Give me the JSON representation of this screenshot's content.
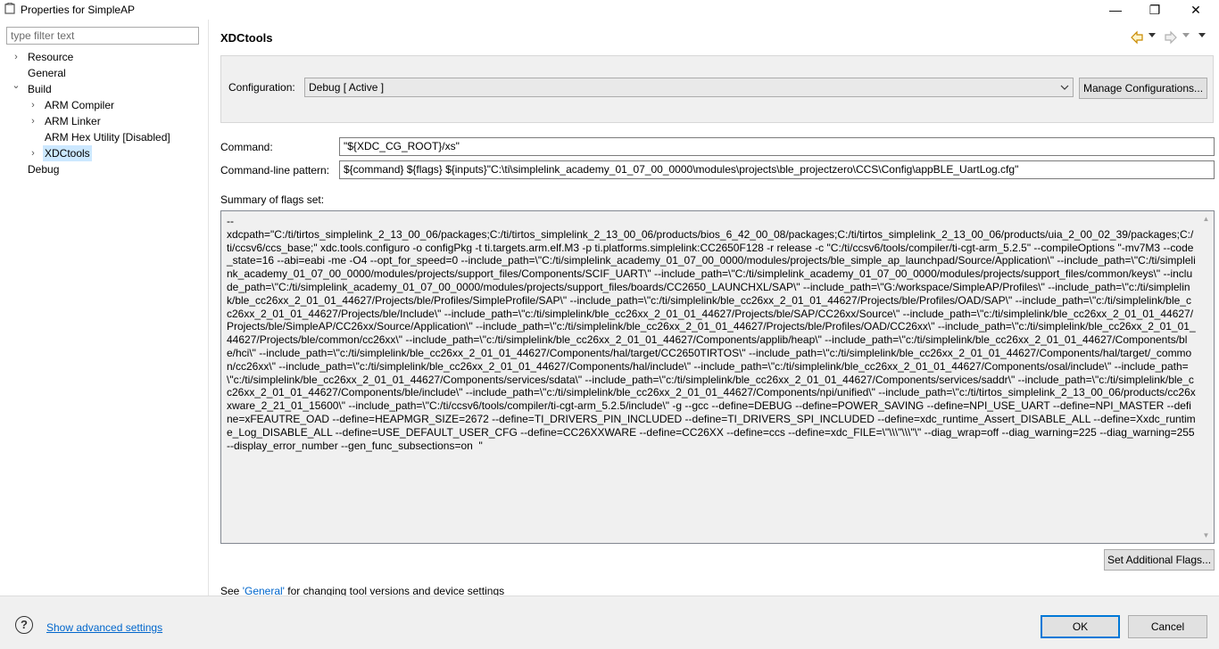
{
  "window": {
    "title": "Properties for SimpleAP",
    "minimize_glyph": "—",
    "maximize_glyph": "❐",
    "close_glyph": "✕"
  },
  "sidebar": {
    "filter_placeholder": "type filter text",
    "items": [
      {
        "label": "Resource",
        "arrow": "›"
      },
      {
        "label": "General",
        "arrow": ""
      },
      {
        "label": "Build",
        "arrow": "⌄"
      },
      {
        "label": "ARM Compiler",
        "arrow": "›"
      },
      {
        "label": "ARM Linker",
        "arrow": "›"
      },
      {
        "label": "ARM Hex Utility  [Disabled]",
        "arrow": ""
      },
      {
        "label": "XDCtools",
        "arrow": "›"
      },
      {
        "label": "Debug",
        "arrow": ""
      }
    ]
  },
  "main": {
    "title": "XDCtools",
    "configuration_label": "Configuration:",
    "configuration_value": "Debug  [ Active ]",
    "manage_button": "Manage Configurations...",
    "command_label": "Command:",
    "command_value": "\"${XDC_CG_ROOT}/xs\"",
    "pattern_label": "Command-line pattern:",
    "pattern_value": "${command} ${flags} ${inputs}\"C:\\ti\\simplelink_academy_01_07_00_0000\\modules\\projects\\ble_projectzero\\CCS\\Config\\appBLE_UartLog.cfg\"",
    "summary_label": "Summary of flags set:",
    "summary_text": "--\nxdcpath=\"C:/ti/tirtos_simplelink_2_13_00_06/packages;C:/ti/tirtos_simplelink_2_13_00_06/products/bios_6_42_00_08/packages;C:/ti/tirtos_simplelink_2_13_00_06/products/uia_2_00_02_39/packages;C:/ti/ccsv6/ccs_base;\" xdc.tools.configuro -o configPkg -t ti.targets.arm.elf.M3 -p ti.platforms.simplelink:CC2650F128 -r release -c \"C:/ti/ccsv6/tools/compiler/ti-cgt-arm_5.2.5\" --compileOptions \"-mv7M3 --code_state=16 --abi=eabi -me -O4 --opt_for_speed=0 --include_path=\\\"C:/ti/simplelink_academy_01_07_00_0000/modules/projects/ble_simple_ap_launchpad/Source/Application\\\" --include_path=\\\"C:/ti/simplelink_academy_01_07_00_0000/modules/projects/support_files/Components/SCIF_UART\\\" --include_path=\\\"C:/ti/simplelink_academy_01_07_00_0000/modules/projects/support_files/common/keys\\\" --include_path=\\\"C:/ti/simplelink_academy_01_07_00_0000/modules/projects/support_files/boards/CC2650_LAUNCHXL/SAP\\\" --include_path=\\\"G:/workspace/SimpleAP/Profiles\\\" --include_path=\\\"c:/ti/simplelink/ble_cc26xx_2_01_01_44627/Projects/ble/Profiles/SimpleProfile/SAP\\\" --include_path=\\\"c:/ti/simplelink/ble_cc26xx_2_01_01_44627/Projects/ble/Profiles/OAD/SAP\\\" --include_path=\\\"c:/ti/simplelink/ble_cc26xx_2_01_01_44627/Projects/ble/Include\\\" --include_path=\\\"c:/ti/simplelink/ble_cc26xx_2_01_01_44627/Projects/ble/SAP/CC26xx/Source\\\" --include_path=\\\"c:/ti/simplelink/ble_cc26xx_2_01_01_44627/Projects/ble/SimpleAP/CC26xx/Source/Application\\\" --include_path=\\\"c:/ti/simplelink/ble_cc26xx_2_01_01_44627/Projects/ble/Profiles/OAD/CC26xx\\\" --include_path=\\\"c:/ti/simplelink/ble_cc26xx_2_01_01_44627/Projects/ble/common/cc26xx\\\" --include_path=\\\"c:/ti/simplelink/ble_cc26xx_2_01_01_44627/Components/applib/heap\\\" --include_path=\\\"c:/ti/simplelink/ble_cc26xx_2_01_01_44627/Components/ble/hci\\\" --include_path=\\\"c:/ti/simplelink/ble_cc26xx_2_01_01_44627/Components/hal/target/CC2650TIRTOS\\\" --include_path=\\\"c:/ti/simplelink/ble_cc26xx_2_01_01_44627/Components/hal/target/_common/cc26xx\\\" --include_path=\\\"c:/ti/simplelink/ble_cc26xx_2_01_01_44627/Components/hal/include\\\" --include_path=\\\"c:/ti/simplelink/ble_cc26xx_2_01_01_44627/Components/osal/include\\\" --include_path=\\\"c:/ti/simplelink/ble_cc26xx_2_01_01_44627/Components/services/sdata\\\" --include_path=\\\"c:/ti/simplelink/ble_cc26xx_2_01_01_44627/Components/services/saddr\\\" --include_path=\\\"c:/ti/simplelink/ble_cc26xx_2_01_01_44627/Components/ble/include\\\" --include_path=\\\"c:/ti/simplelink/ble_cc26xx_2_01_01_44627/Components/npi/unified\\\" --include_path=\\\"c:/ti/tirtos_simplelink_2_13_00_06/products/cc26xxware_2_21_01_15600\\\" --include_path=\\\"C:/ti/ccsv6/tools/compiler/ti-cgt-arm_5.2.5/include\\\" -g --gcc --define=DEBUG --define=POWER_SAVING --define=NPI_USE_UART --define=NPI_MASTER --define=xFEAUTRE_OAD --define=HEAPMGR_SIZE=2672 --define=TI_DRIVERS_PIN_INCLUDED --define=TI_DRIVERS_SPI_INCLUDED --define=xdc_runtime_Assert_DISABLE_ALL --define=Xxdc_runtime_Log_DISABLE_ALL --define=USE_DEFAULT_USER_CFG --define=CC26XXWARE --define=CC26XX --define=ccs --define=xdc_FILE=\\\"\\\\\\\"\\\\\\\"\\\" --diag_wrap=off --diag_warning=225 --diag_warning=255 --display_error_number --gen_func_subsections=on  \"",
    "set_flags_button": "Set Additional Flags...",
    "see_prefix": "See ",
    "see_link": "'General'",
    "see_suffix": " for changing tool versions and device settings"
  },
  "footer": {
    "help_glyph": "?",
    "advanced_link": "Show advanced settings",
    "ok_button": "OK",
    "cancel_button": "Cancel"
  },
  "colors": {
    "selection": "#cce8ff",
    "link": "#0066cc",
    "default_button_border": "#0078d7"
  }
}
